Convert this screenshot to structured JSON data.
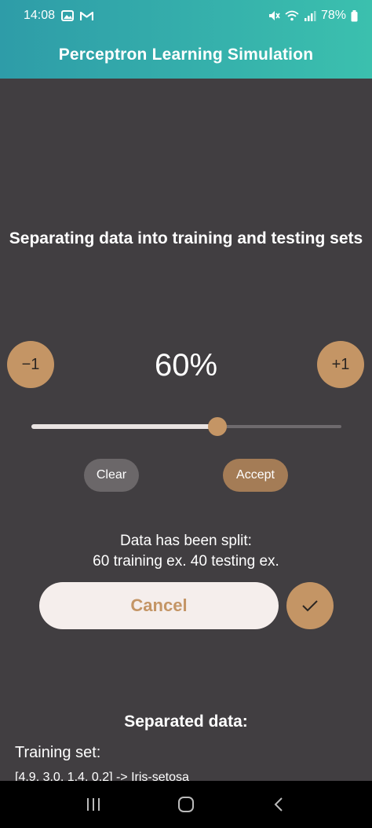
{
  "status_bar": {
    "time": "14:08",
    "battery": "78%"
  },
  "app_bar": {
    "title": "Perceptron Learning Simulation"
  },
  "split": {
    "heading": "Separating data into training and testing sets",
    "minus_label": "−1",
    "plus_label": "+1",
    "percent_label": "60%",
    "slider_value": 0.6,
    "clear_label": "Clear",
    "accept_label": "Accept",
    "result_line1": "Data has been split:",
    "result_line2": "60 training ex. 40 testing ex."
  },
  "actions": {
    "cancel_label": "Cancel"
  },
  "separated": {
    "title": "Separated data:",
    "training_label": "Training set:",
    "first_row": "[4.9, 3.0, 1.4, 0.2] -> Iris-setosa"
  },
  "colors": {
    "accent": "#C49565",
    "header_start": "#2E9CA8",
    "header_end": "#3BC0AE",
    "background": "#413E41"
  }
}
